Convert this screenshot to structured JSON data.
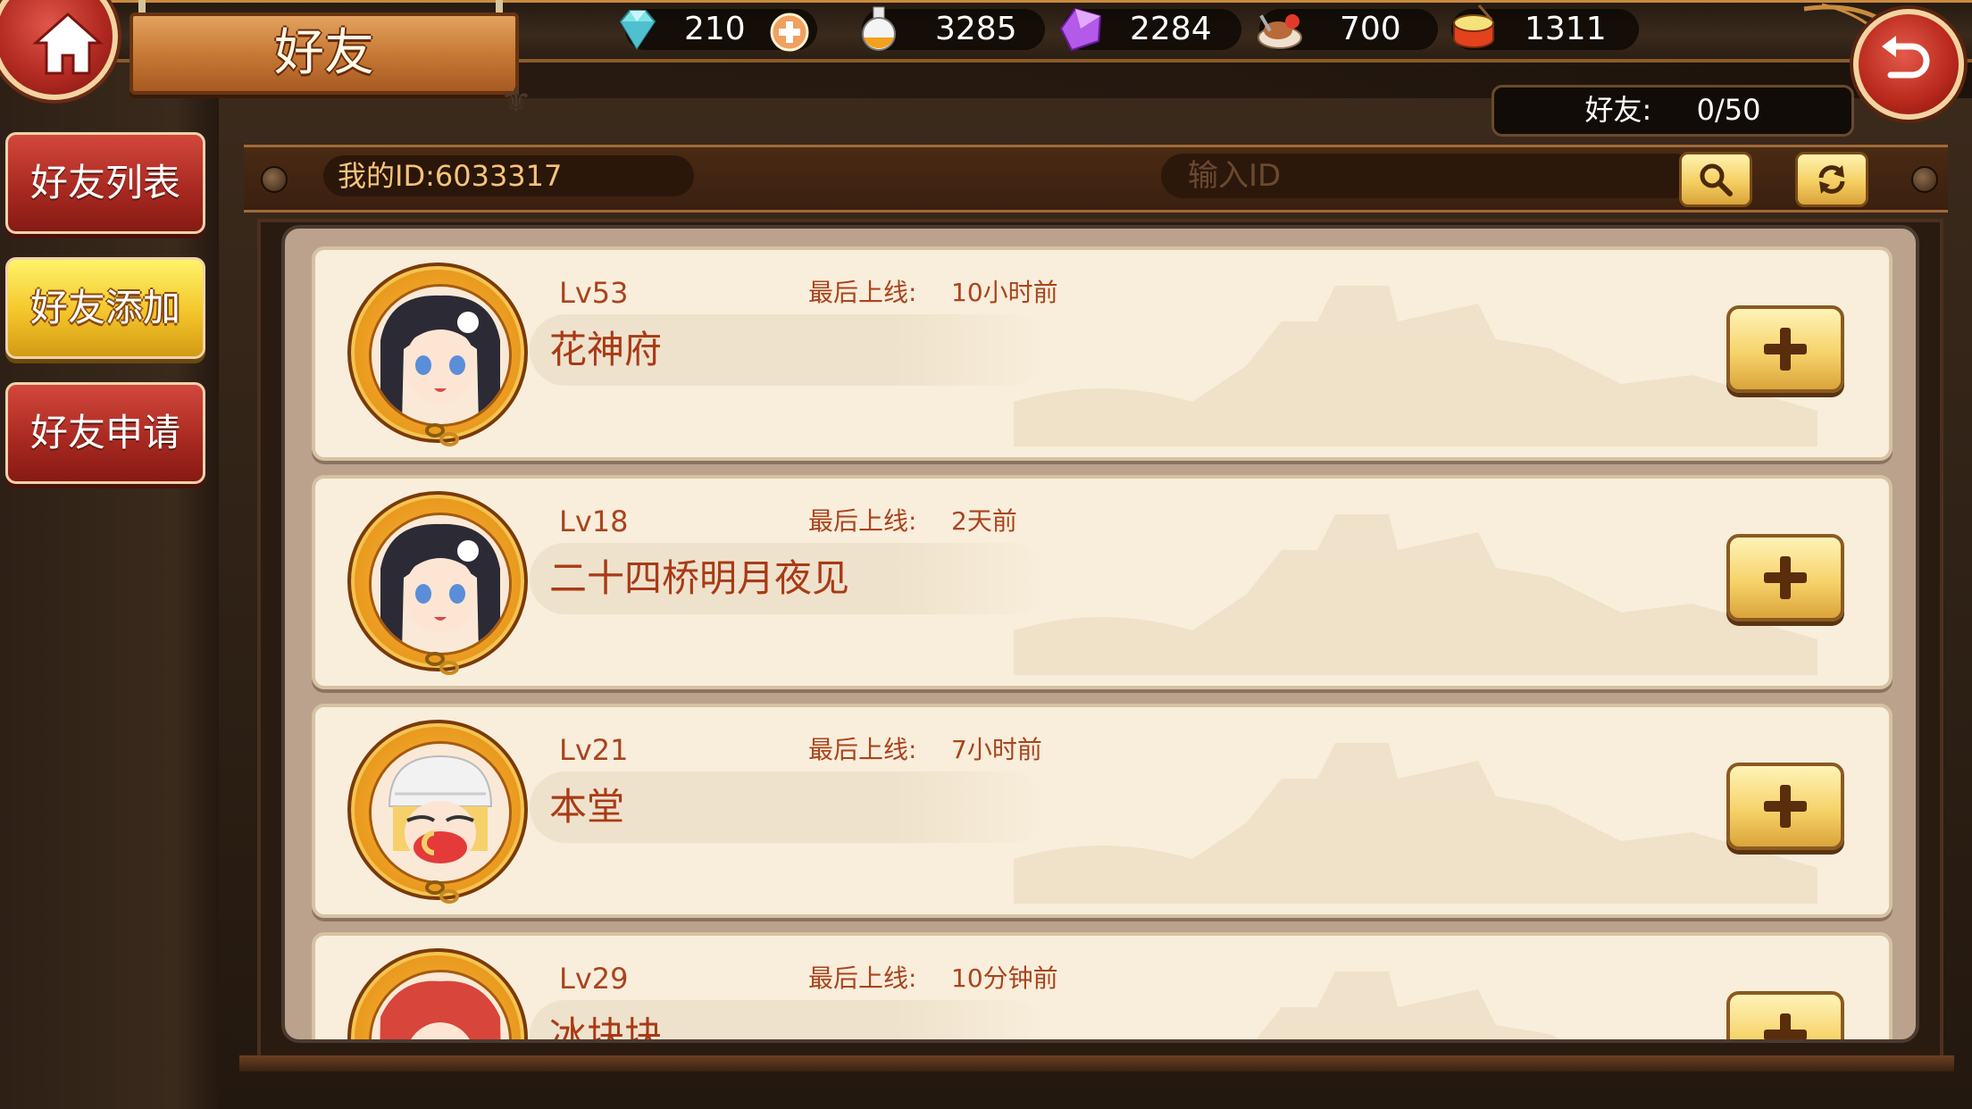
{
  "header": {
    "title": "好友"
  },
  "resources": [
    {
      "icon": "diamond-icon",
      "value": "210",
      "has_add": true
    },
    {
      "icon": "potion-icon",
      "value": "3285",
      "has_add": false
    },
    {
      "icon": "crystal-icon",
      "value": "2284",
      "has_add": false
    },
    {
      "icon": "food-icon",
      "value": "700",
      "has_add": false
    },
    {
      "icon": "drum-icon",
      "value": "1311",
      "has_add": false
    }
  ],
  "friend_count": {
    "label": "好友:",
    "value": "0/50"
  },
  "sidebar": {
    "items": [
      {
        "label": "好友列表",
        "active": false
      },
      {
        "label": "好友添加",
        "active": true
      },
      {
        "label": "好友申请",
        "active": false
      }
    ]
  },
  "search": {
    "my_id_label": "我的ID:6033317",
    "placeholder": "输入ID",
    "value": ""
  },
  "players": [
    {
      "level": "Lv53",
      "last_online_label": "最后上线:",
      "last_online": "10小时前",
      "name": "花神府",
      "avatar": "dark-hair-girl"
    },
    {
      "level": "Lv18",
      "last_online_label": "最后上线:",
      "last_online": "2天前",
      "name": "二十四桥明月夜见",
      "avatar": "dark-hair-girl"
    },
    {
      "level": "Lv21",
      "last_online_label": "最后上线:",
      "last_online": "7小时前",
      "name": "本堂",
      "avatar": "white-hat-girl"
    },
    {
      "level": "Lv29",
      "last_online_label": "最后上线:",
      "last_online": "10分钟前",
      "name": "冰块块",
      "avatar": "red-hair-girl"
    }
  ],
  "colors": {
    "accent_gold": "#f5cf62",
    "button_red": "#b32a22",
    "text_brown": "#a9441e",
    "card_bg": "#f8eedb"
  }
}
